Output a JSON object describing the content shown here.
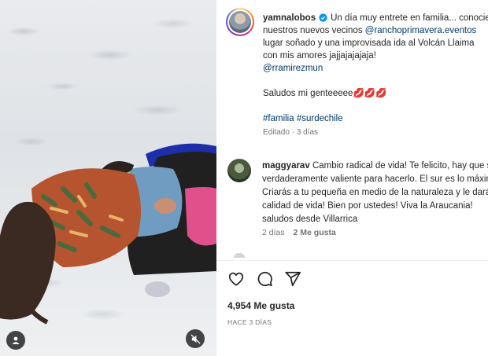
{
  "post": {
    "username": "yamnalobos",
    "caption_lines": [
      "Un día muy entrete en familia... conociendo",
      "nuestros nuevos vecinos",
      "lugar soñado y una improvisada ida al Volcán Llaima",
      "con mis amores jajjajajajaja!"
    ],
    "mention_1": "@ranchoprimavera.eventos",
    "mention_2": "@rramirezmun",
    "greeting": "Saludos mi genteeeee💋💋💋",
    "hashtags": "#familia #surdechile",
    "edited": "Editado · 3 días"
  },
  "comment": {
    "username": "maggyarav",
    "lines": [
      "Cambio radical de vida! Te felicito, hay que ser",
      "verdaderamente valiente para hacerlo. El sur es lo máximo!",
      "Criarás a tu pequeña en medio de la naturaleza y le darás",
      "calidad de vida! Bien por ustedes! Viva la Araucania!",
      "saludos desde Villarrica"
    ],
    "age": "2 días",
    "likes": "2 Me gusta"
  },
  "actions": {
    "likes_count": "4,954 Me gusta",
    "posted": "HACE 3 DÍAS"
  },
  "icons": {
    "like": "heart-icon",
    "comment": "comment-icon",
    "share": "share-icon",
    "mute": "speaker-muted-icon",
    "user": "user-tag-icon",
    "verified": "verified-badge-icon"
  },
  "colors": {
    "link": "#00376b",
    "verified": "#0095f6",
    "muted_text": "#737373"
  }
}
